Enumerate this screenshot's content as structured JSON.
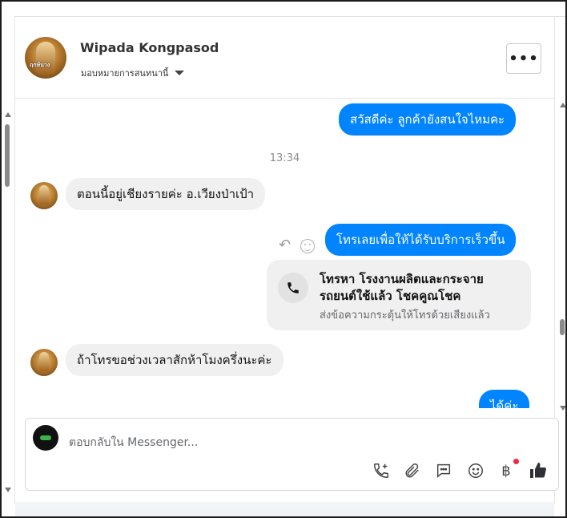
{
  "header": {
    "contact_name": "Wipada Kongpasod",
    "assign_label": "มอบหมายการสนทนานี้",
    "avatar_tag": "ฤกษ์นาง",
    "more_label": "•••"
  },
  "messages": [
    {
      "direction": "out",
      "text": "สวัสดีค่ะ ลูกค้ายังสนใจไหมคะ"
    },
    {
      "direction": "time",
      "text": "13:34"
    },
    {
      "direction": "in",
      "text": "ตอนนี้อยู่เชียงรายค่ะ อ.เวียงป่าเป้า"
    },
    {
      "direction": "out",
      "text": "โทรเลยเพื่อให้ได้รับบริการเร็วขึ้น"
    },
    {
      "direction": "call",
      "title": "โทรหา โรงงานผลิตและกระจายรถยนต์ใช้แล้ว โชคคูณโชค",
      "sub": "ส่งข้อความกระตุ้นให้โทรด้วยเสียงแล้ว"
    },
    {
      "direction": "in",
      "text": "ถ้าโทรขอช่วงเวลาสักห้าโมงครึ่งนะค่ะ"
    },
    {
      "direction": "out",
      "text": "ได้ค่ะ"
    }
  ],
  "composer": {
    "placeholder": "ตอบกลับใน Messenger...",
    "tools": [
      "add-call-icon",
      "attachment-icon",
      "saved-reply-icon",
      "emoji-icon",
      "baht-payment-icon",
      "like-icon"
    ],
    "baht_symbol": "฿"
  },
  "colors": {
    "outgoing_bubble": "#0084ff",
    "incoming_bubble": "#f0f0f0",
    "notification_dot": "#f02849"
  }
}
